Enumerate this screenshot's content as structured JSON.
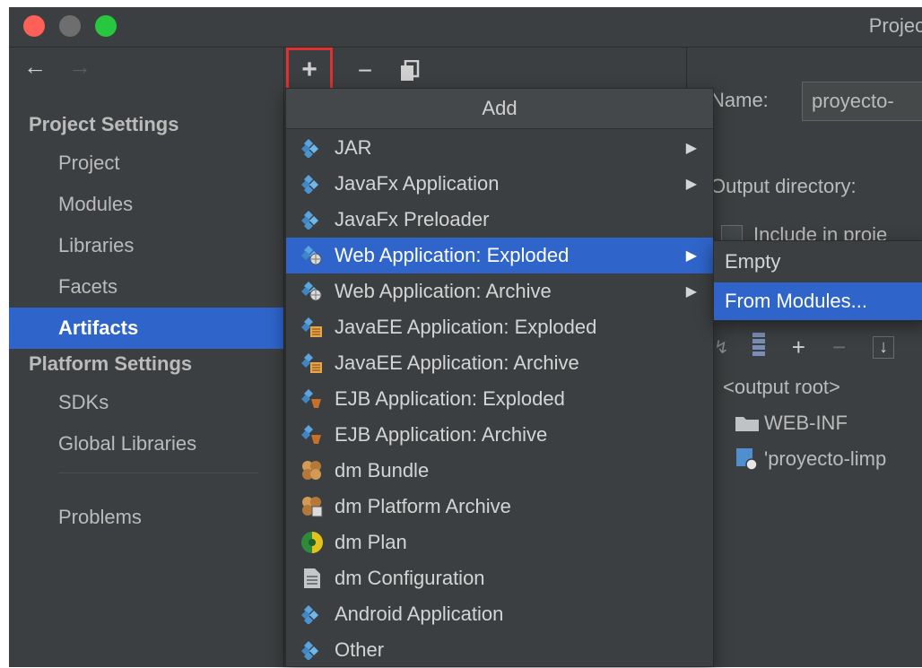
{
  "window": {
    "title": "Project S",
    "traffic_lights": [
      "#fe5f57",
      "#6e6e6e",
      "#27c840"
    ]
  },
  "sidebar": {
    "back_icon": "arrow-left-icon",
    "forward_icon": "arrow-right-icon",
    "project_settings_heading": "Project Settings",
    "platform_settings_heading": "Platform Settings",
    "project_items": [
      "Project",
      "Modules",
      "Libraries",
      "Facets",
      "Artifacts"
    ],
    "platform_items": [
      "SDKs",
      "Global Libraries"
    ],
    "problems": "Problems",
    "selected": "Artifacts"
  },
  "toolbar": {
    "add": "+",
    "remove": "−",
    "copy_icon": "copy-icon",
    "highlight_color": "#e2302f"
  },
  "add_menu": {
    "header": "Add",
    "items": [
      {
        "label": "JAR",
        "icon": "artifact-icon",
        "submenu": true
      },
      {
        "label": "JavaFx Application",
        "icon": "artifact-icon",
        "submenu": true
      },
      {
        "label": "JavaFx Preloader",
        "icon": "artifact-icon",
        "submenu": false
      },
      {
        "label": "Web Application: Exploded",
        "icon": "web-app-icon",
        "submenu": true
      },
      {
        "label": "Web Application: Archive",
        "icon": "web-app-icon",
        "submenu": true
      },
      {
        "label": "JavaEE Application: Exploded",
        "icon": "javaee-icon",
        "submenu": false
      },
      {
        "label": "JavaEE Application: Archive",
        "icon": "javaee-icon",
        "submenu": false
      },
      {
        "label": "EJB Application: Exploded",
        "icon": "ejb-icon",
        "submenu": false
      },
      {
        "label": "EJB Application: Archive",
        "icon": "ejb-icon",
        "submenu": false
      },
      {
        "label": "dm Bundle",
        "icon": "dm-bundle-icon",
        "submenu": false
      },
      {
        "label": "dm Platform Archive",
        "icon": "dm-platform-icon",
        "submenu": false
      },
      {
        "label": "dm Plan",
        "icon": "dm-plan-icon",
        "submenu": false
      },
      {
        "label": "dm Configuration",
        "icon": "document-icon",
        "submenu": false
      },
      {
        "label": "Android Application",
        "icon": "artifact-icon",
        "submenu": false
      },
      {
        "label": "Other",
        "icon": "artifact-icon",
        "submenu": false
      }
    ],
    "highlighted": "Web Application: Exploded",
    "highlight_color": "#2f65ca"
  },
  "submenu": {
    "items": [
      "Empty",
      "From Modules..."
    ],
    "highlighted": "From Modules..."
  },
  "right_panel": {
    "name_label": "Name:",
    "name_value": "proyecto-",
    "output_dir_label": "Output directory:",
    "include_label": "Include in proje",
    "tree": {
      "output_root": "<output root>",
      "web_inf": "WEB-INF",
      "module": "'proyecto-limp"
    }
  }
}
